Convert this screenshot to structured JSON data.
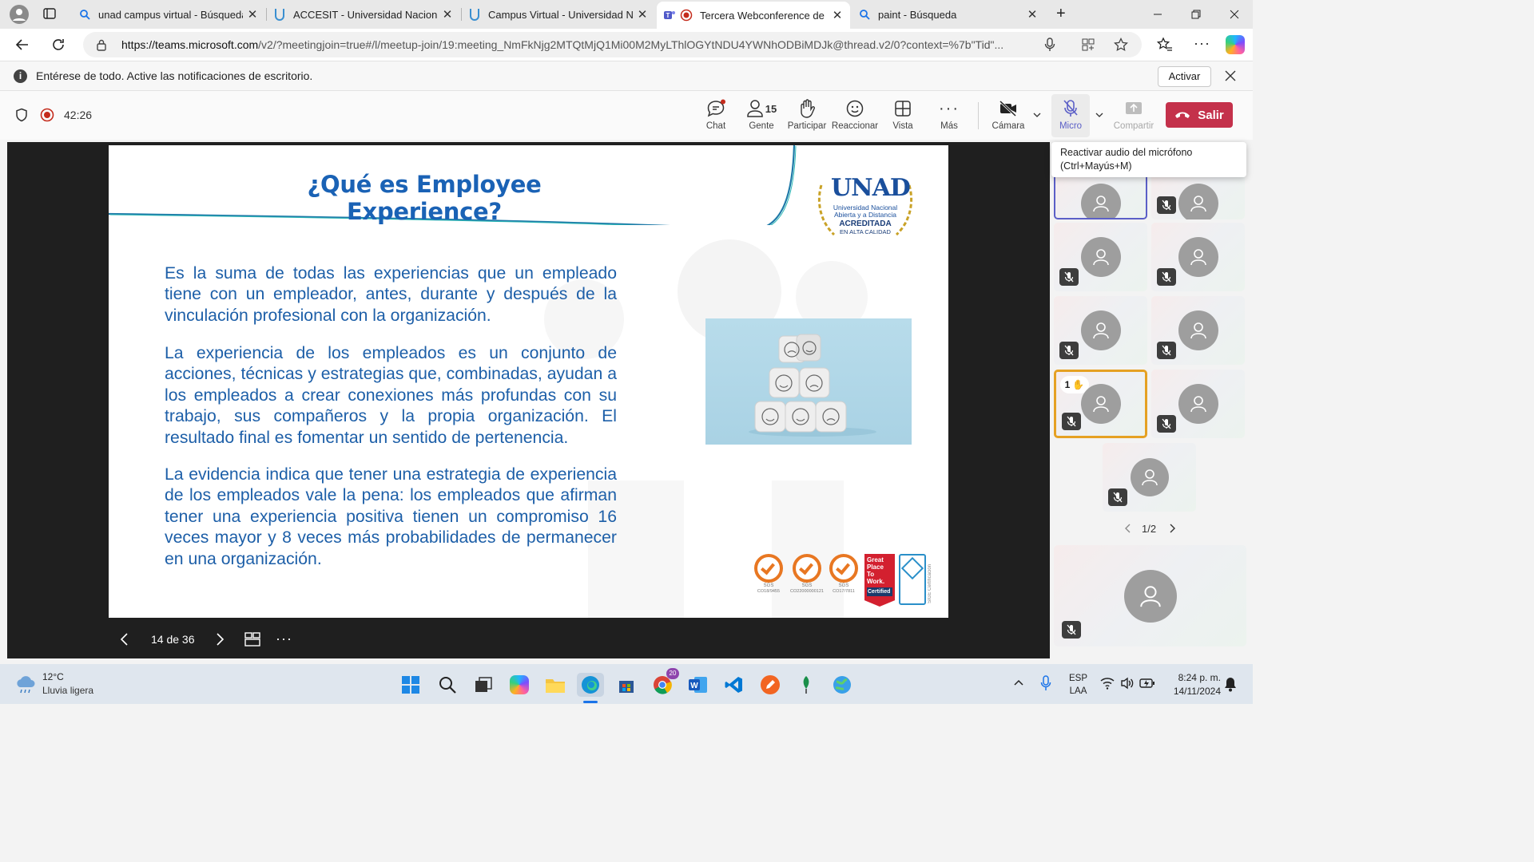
{
  "tabs": [
    {
      "title": "unad campus virtual - Búsqueda",
      "favicon": "search-icon"
    },
    {
      "title": "ACCESIT - Universidad Nacional A",
      "favicon": "unad-icon"
    },
    {
      "title": "Campus Virtual - Universidad Nac",
      "favicon": "unad-icon"
    },
    {
      "title": "Tercera Webconference de B",
      "favicon": "teams-icon",
      "active": true
    },
    {
      "title": "paint - Búsqueda",
      "favicon": "search-icon"
    }
  ],
  "address": {
    "url_host": "https://teams.microsoft.com",
    "url_path": "/v2/?meetingjoin=true#/l/meetup-join/19:meeting_NmFkNjg2MTQtMjQ1Mi00M2MyLThlOGYtNDU4YWNhODBiMDJk@thread.v2/0?context=%7b\"Tid\"..."
  },
  "notification": {
    "text": "Entérese de todo. Active las notificaciones de escritorio.",
    "button": "Activar"
  },
  "meeting": {
    "timer": "42:26",
    "people_count": "15",
    "buttons": {
      "chat": "Chat",
      "people": "Gente",
      "raise": "Participar",
      "react": "Reaccionar",
      "view": "Vista",
      "more": "Más",
      "camera": "Cámara",
      "mic": "Micro",
      "share": "Compartir",
      "leave": "Salir"
    },
    "tooltip": {
      "line1": "Reactivar audio del micrófono",
      "line2": "(Ctrl+Mayús+M)"
    }
  },
  "slide": {
    "title": "¿Qué es Employee Experience?",
    "paragraphs": [
      "Es la suma de todas las experiencias que un empleado tiene con un empleador, antes, durante y después de la vinculación profesional con la organización.",
      "La experiencia de los empleados es un conjunto de acciones, técnicas y estrategias que, combinadas, ayudan a los empleados a crear conexiones más profundas con su trabajo, sus compañeros y la propia organización. El resultado final es fomentar un sentido de pertenencia.",
      "La evidencia indica que tener una estrategia de experiencia de los empleados vale la pena: los empleados que afirman tener una experiencia positiva tienen un compromiso 16 veces mayor y 8 veces más probabilidades de permanecer en una organización."
    ],
    "logo": {
      "line1": "UNAD",
      "line2": "Universidad Nacional",
      "line3": "Abierta y a Distancia",
      "line4": "ACREDITADA",
      "line5": "EN ALTA CALIDAD"
    },
    "certs": [
      {
        "label": "SGS",
        "code": "CO18/9455"
      },
      {
        "label": "SGS",
        "code": "CO22000000121"
      },
      {
        "label": "SGS",
        "code": "CO17/7811"
      }
    ],
    "gptw": {
      "line1": "Great",
      "line2": "Place",
      "line3": "To",
      "line4": "Work.",
      "line5": "Certified"
    },
    "side_code": "SIGE Certificación"
  },
  "slide_nav": {
    "page": "14 de 36"
  },
  "panel": {
    "raised_count": "1",
    "pager": "1/2"
  },
  "taskbar": {
    "weather_temp": "12°C",
    "weather_desc": "Lluvia ligera",
    "lang1": "ESP",
    "lang2": "LAA",
    "time": "8:24 p. m.",
    "date": "14/11/2024",
    "chrome_badge": "20"
  }
}
